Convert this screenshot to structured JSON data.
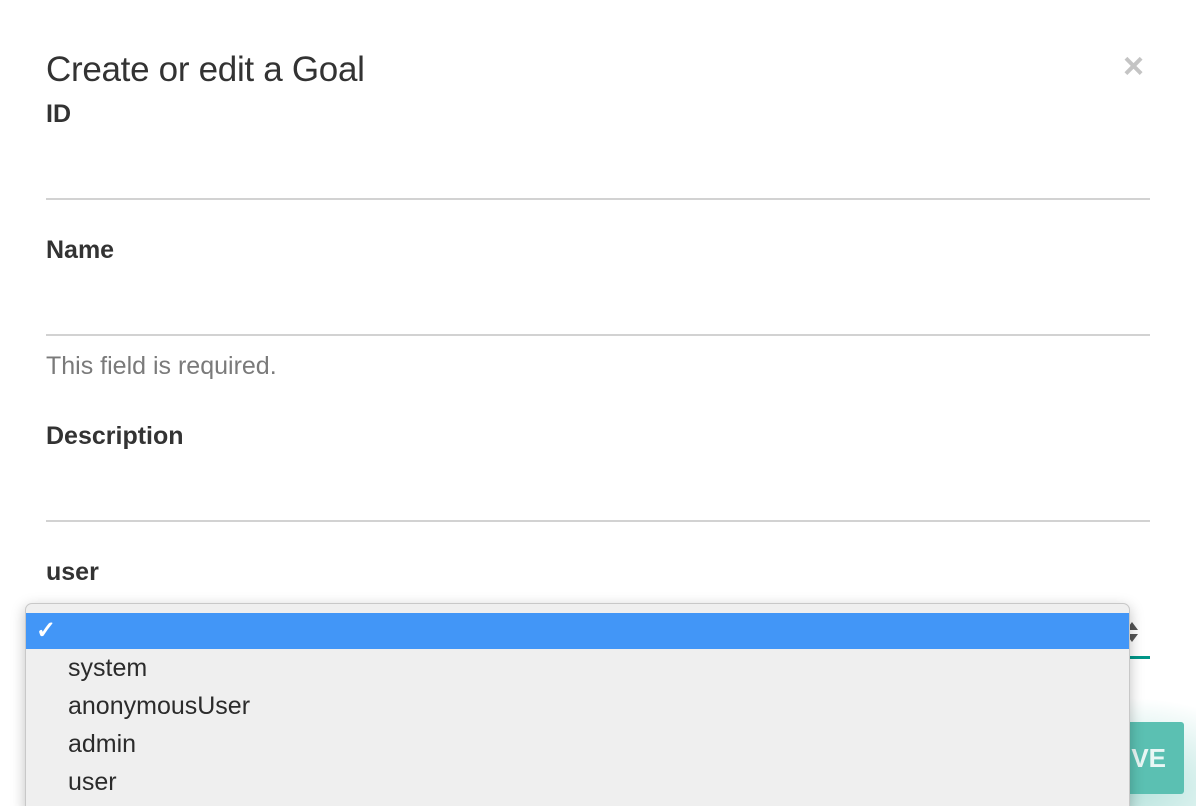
{
  "dialog": {
    "title": "Create or edit a Goal",
    "close_label": "×"
  },
  "fields": {
    "id": {
      "label": "ID",
      "value": ""
    },
    "name": {
      "label": "Name",
      "value": "",
      "help": "This field is required."
    },
    "description": {
      "label": "Description",
      "value": ""
    },
    "user": {
      "label": "user",
      "check_mark": "✓",
      "options": [
        "",
        "system",
        "anonymousUser",
        "admin",
        "user"
      ],
      "selected_index": 0
    }
  },
  "footer": {
    "save_label": "SAVE",
    "save_visible_text": "VE"
  },
  "colors": {
    "accent": "#009688",
    "save_button": "#5bc0b2",
    "dropdown_highlight": "#4296f7"
  }
}
